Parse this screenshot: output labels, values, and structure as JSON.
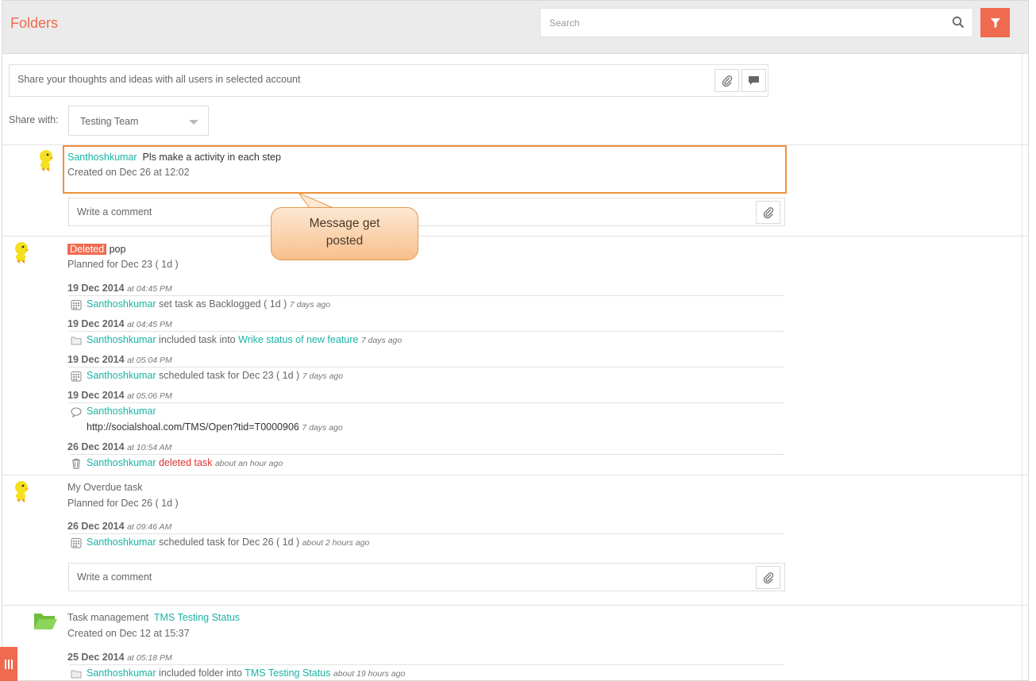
{
  "header": {
    "title": "Folders",
    "search_placeholder": "Search"
  },
  "composer": {
    "placeholder": "Share your thoughts and ideas with all users in selected account",
    "share_with_label": "Share with:",
    "share_with_value": "Testing Team"
  },
  "comment_placeholder": "Write a comment",
  "post1": {
    "author": "Santhoshkumar",
    "message": "Pls make a activity in each step",
    "created": "Created on Dec 26 at 12:02"
  },
  "callout": {
    "line1": "Message get",
    "line2": "posted"
  },
  "task1": {
    "badge": "Deleted",
    "name": "pop",
    "planned": "Planned for Dec 23 ( 1d )",
    "activities": [
      {
        "date": "19 Dec 2014",
        "time": "at 04:45 PM",
        "author": "Santhoshkumar",
        "text": "set task as Backlogged ( 1d )",
        "ago": "7 days ago"
      },
      {
        "date": "19 Dec 2014",
        "time": "at 04:45 PM",
        "author": "Santhoshkumar",
        "text": "included task into",
        "link": "Wrike status of new feature",
        "ago": "7 days ago"
      },
      {
        "date": "19 Dec 2014",
        "time": "at 05:04 PM",
        "author": "Santhoshkumar",
        "text": "scheduled task for Dec 23 ( 1d )",
        "ago": "7 days ago"
      },
      {
        "date": "19 Dec 2014",
        "time": "at 05:06 PM",
        "author": "Santhoshkumar",
        "text": "http://socialshoal.com/TMS/Open?tid=T0000906",
        "ago": "7 days ago"
      },
      {
        "date": "26 Dec 2014",
        "time": "at 10:54 AM",
        "author": "Santhoshkumar",
        "text": "deleted task",
        "ago": "about an hour ago"
      }
    ]
  },
  "task2": {
    "name": "My Overdue task",
    "planned": "Planned for Dec 26 ( 1d )",
    "activities": [
      {
        "date": "26 Dec 2014",
        "time": "at 09:46 AM",
        "author": "Santhoshkumar",
        "text": "scheduled task for Dec 26 ( 1d )",
        "ago": "about 2 hours ago"
      }
    ]
  },
  "folder1": {
    "prefix": "Task management",
    "link": "TMS Testing Status",
    "created": "Created on Dec 12 at 15:37",
    "activities": [
      {
        "date": "25 Dec 2014",
        "time": "at 05:18 PM",
        "author": "Santhoshkumar",
        "text": "included folder into",
        "link": "TMS Testing Status",
        "ago": "about 19 hours ago"
      }
    ]
  },
  "colors": {
    "accent": "#f06a4f",
    "link": "#1ab3a4",
    "highlight_border": "#f0903a",
    "danger": "#e03030"
  },
  "icons": [
    "search-icon",
    "filter-icon",
    "paperclip-icon",
    "chat-icon",
    "calendar-icon",
    "folder-icon",
    "speech-bubble-icon",
    "trash-icon",
    "avatar-icon",
    "folder-open-icon",
    "menu-bars-icon"
  ]
}
